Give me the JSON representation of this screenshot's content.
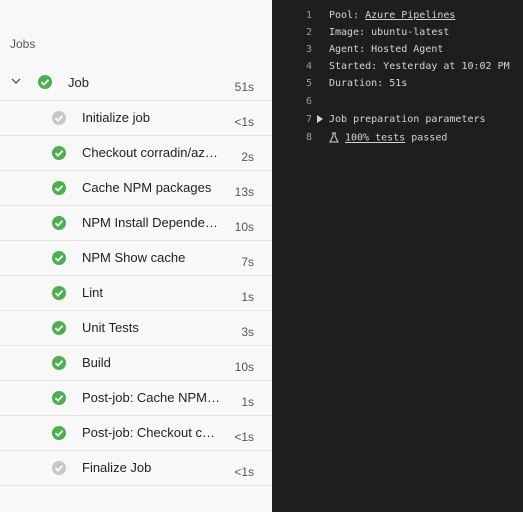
{
  "left_panel": {
    "section_title": "Jobs",
    "job": {
      "label": "Job",
      "duration": "51s",
      "status": "success"
    },
    "steps": [
      {
        "label": "Initialize job",
        "duration": "<1s",
        "status": "skipped"
      },
      {
        "label": "Checkout corradin/azure-pipelines",
        "duration": "2s",
        "status": "success"
      },
      {
        "label": "Cache NPM packages",
        "duration": "13s",
        "status": "success"
      },
      {
        "label": "NPM Install Dependencies",
        "duration": "10s",
        "status": "success"
      },
      {
        "label": "NPM Show cache",
        "duration": "7s",
        "status": "success"
      },
      {
        "label": "Lint",
        "duration": "1s",
        "status": "success"
      },
      {
        "label": "Unit Tests",
        "duration": "3s",
        "status": "success"
      },
      {
        "label": "Build",
        "duration": "10s",
        "status": "success"
      },
      {
        "label": "Post-job: Cache NPM packages",
        "duration": "1s",
        "status": "success"
      },
      {
        "label": "Post-job: Checkout corradin/azure-pipelines",
        "duration": "<1s",
        "status": "success"
      },
      {
        "label": "Finalize Job",
        "duration": "<1s",
        "status": "skipped"
      }
    ]
  },
  "log": {
    "lines": [
      {
        "num": "1",
        "prefix": "Pool: ",
        "link": "Azure Pipelines",
        "suffix": ""
      },
      {
        "num": "2",
        "prefix": "Image: ubuntu-latest",
        "link": "",
        "suffix": ""
      },
      {
        "num": "3",
        "prefix": "Agent: Hosted Agent",
        "link": "",
        "suffix": ""
      },
      {
        "num": "4",
        "prefix": "Started: Yesterday at 10:02 PM",
        "link": "",
        "suffix": ""
      },
      {
        "num": "5",
        "prefix": "Duration: 51s",
        "link": "",
        "suffix": ""
      },
      {
        "num": "6",
        "prefix": "",
        "link": "",
        "suffix": ""
      },
      {
        "num": "7",
        "prefix": "Job preparation parameters",
        "link": "",
        "suffix": "",
        "expandable": true
      },
      {
        "num": "8",
        "prefix": "",
        "link": "100% tests",
        "suffix": " passed",
        "icon": "flask-icon"
      }
    ]
  },
  "colors": {
    "success": "#4caf50",
    "skipped": "#c8c8c8",
    "log_bg": "#1e1e1e"
  }
}
